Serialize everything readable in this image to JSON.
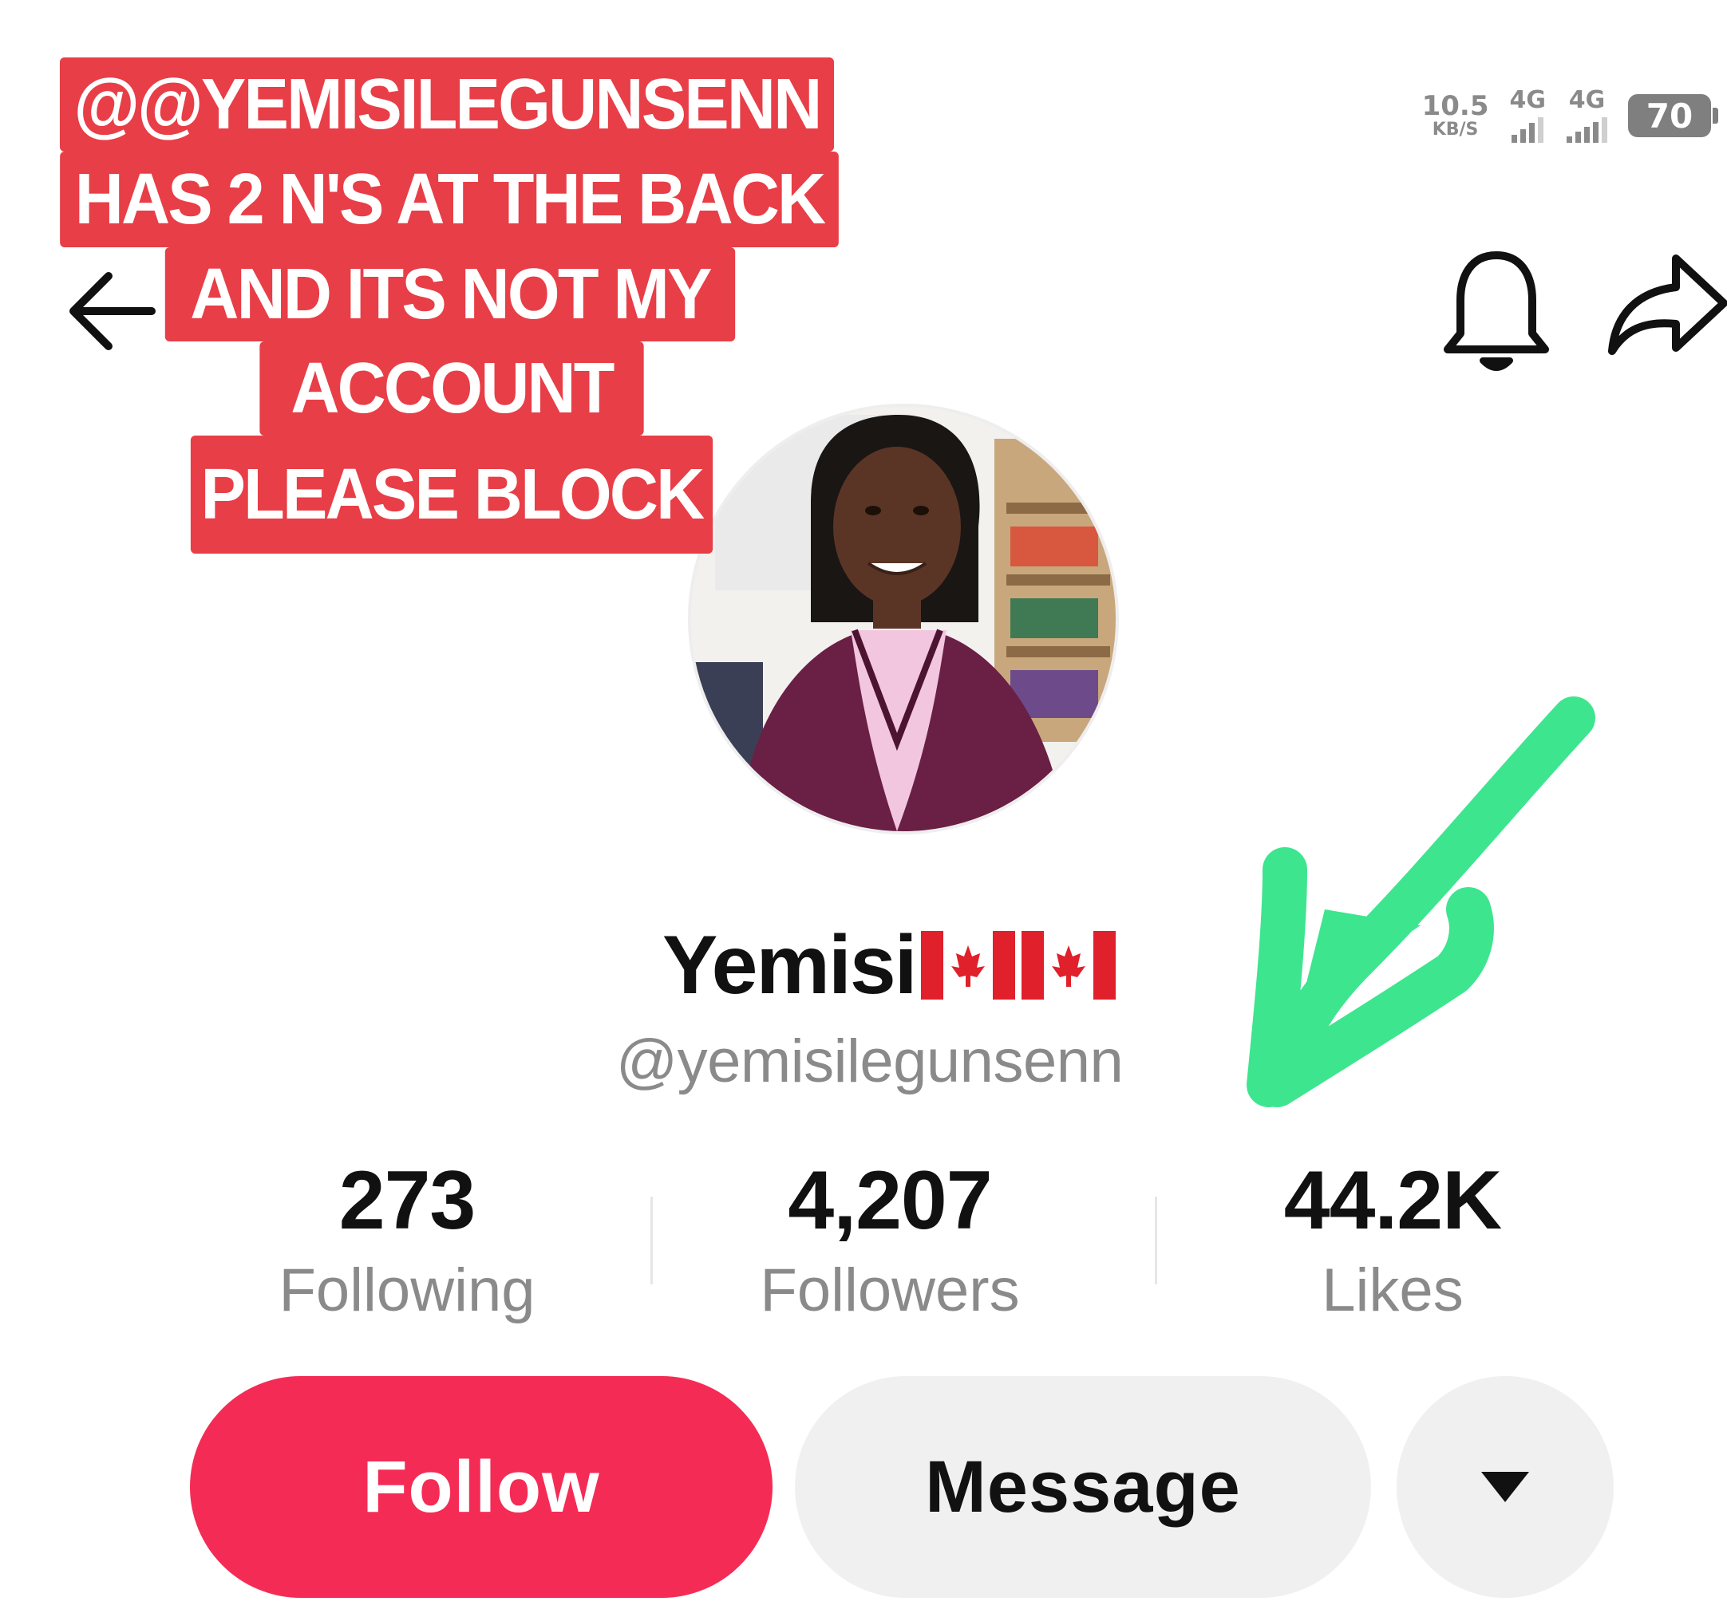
{
  "status_bar": {
    "net_speed": "10.5",
    "net_speed_unit": "KB/S",
    "sim1_label": "4G",
    "sim2_label": "4G",
    "battery": "70"
  },
  "overlay_caption": {
    "lines": [
      "@@YEMISILEGUNSENN",
      "HAS 2 N'S AT THE BACK",
      "AND ITS NOT MY",
      "ACCOUNT",
      "PLEASE BLOCK"
    ],
    "background_color": "#e83e47"
  },
  "profile": {
    "display_name": "Yemisi",
    "flags": [
      "canada-flag-icon",
      "canada-flag-icon"
    ],
    "handle": "@yemisilegunsenn"
  },
  "stats": [
    {
      "value": "273",
      "label": "Following"
    },
    {
      "value": "4,207",
      "label": "Followers"
    },
    {
      "value": "44.2K",
      "label": "Likes"
    }
  ],
  "actions": {
    "follow_label": "Follow",
    "message_label": "Message",
    "more_icon": "triangle-down-icon"
  },
  "icons": {
    "back": "arrow-left-icon",
    "notifications": "bell-icon",
    "share": "share-arrow-icon"
  },
  "colors": {
    "follow_button": "#f42c55",
    "annotation_arrow": "#3de58f"
  }
}
